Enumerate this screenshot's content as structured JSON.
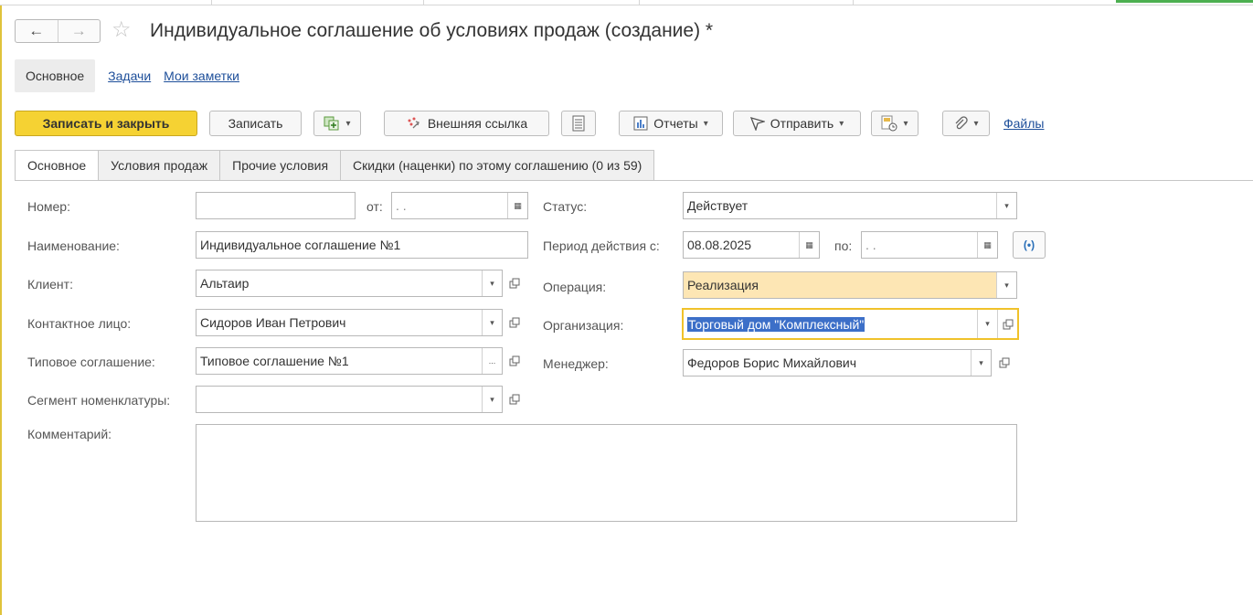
{
  "window": {
    "title": "Индивидуальное соглашение об условиях продаж (создание) *",
    "back_glyph": "←",
    "forward_glyph": "→",
    "star_glyph": "☆"
  },
  "sections": {
    "active": "Основное",
    "links": [
      "Задачи",
      "Мои заметки"
    ]
  },
  "toolbar": {
    "save_close": "Записать и закрыть",
    "save": "Записать",
    "external_link": "Внешняя ссылка",
    "reports": "Отчеты",
    "send": "Отправить",
    "files": "Файлы"
  },
  "tabs": [
    "Основное",
    "Условия продаж",
    "Прочие условия",
    "Скидки (наценки) по этому соглашению (0 из 59)"
  ],
  "form": {
    "number_label": "Номер:",
    "number_value": "",
    "from_label": "от:",
    "from_value": " .  .",
    "name_label": "Наименование:",
    "name_value": "Индивидуальное соглашение №1",
    "client_label": "Клиент:",
    "client_value": "Альтаир",
    "contact_label": "Контактное лицо:",
    "contact_value": "Сидоров Иван Петрович",
    "template_label": "Типовое соглашение:",
    "template_value": "Типовое соглашение №1",
    "segment_label": "Сегмент номенклатуры:",
    "segment_value": "",
    "comment_label": "Комментарий:",
    "comment_value": "",
    "status_label": "Статус:",
    "status_value": "Действует",
    "period_label": "Период действия с:",
    "period_from": "08.08.2025",
    "period_to_label": "по:",
    "period_to": " .  .",
    "period_btn": "(•)",
    "operation_label": "Операция:",
    "operation_value": "Реализация",
    "org_label": "Организация:",
    "org_value": "Торговый дом \"Комплексный\"",
    "manager_label": "Менеджер:",
    "manager_value": "Федоров Борис Михайлович"
  },
  "glyphs": {
    "dropdown": "▾",
    "ellipsis": "...",
    "calendar": "▦"
  },
  "colors": {
    "primary_button": "#f5d233",
    "link": "#1e4f9a",
    "highlight_field": "#fde6b4",
    "focus_border": "#f0c22a",
    "selection": "#3c6fc8"
  }
}
